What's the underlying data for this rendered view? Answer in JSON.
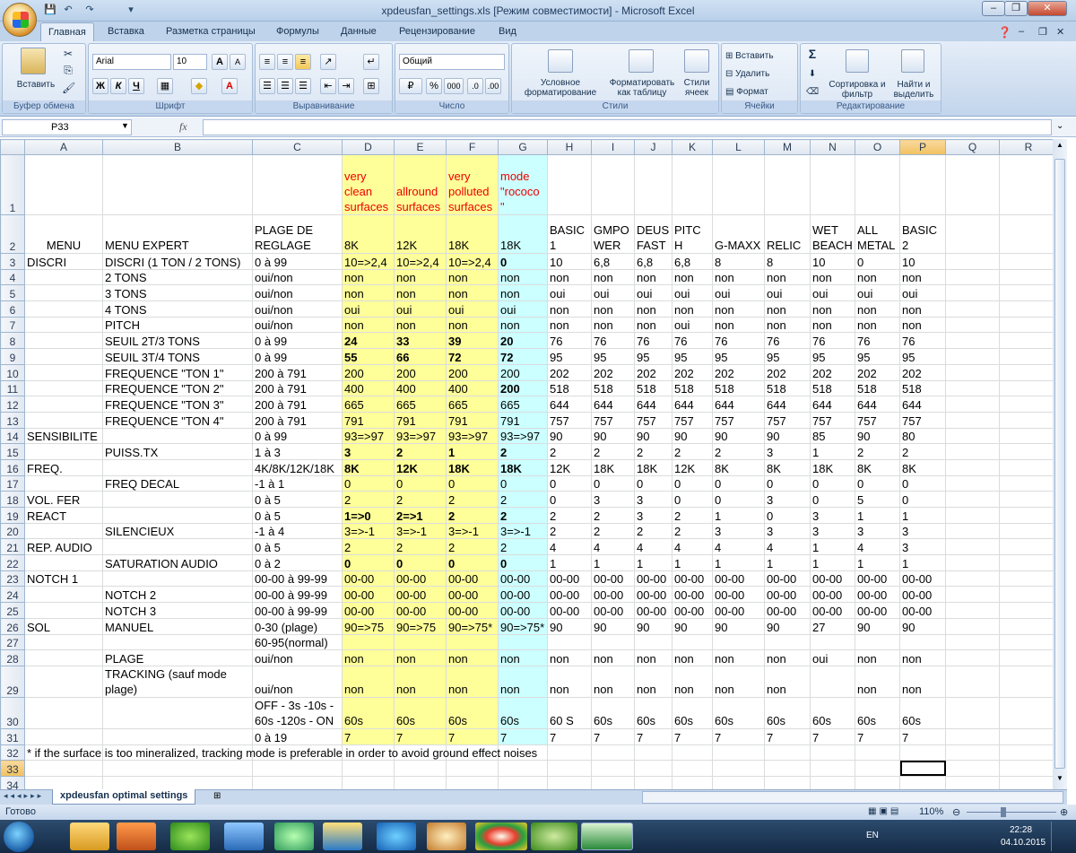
{
  "window": {
    "title": "xpdeusfan_settings.xls  [Режим совместимости] - Microsoft Excel",
    "min": "–",
    "max": "❐",
    "close": "✕"
  },
  "ribbon_tabs": [
    "Главная",
    "Вставка",
    "Разметка страницы",
    "Формулы",
    "Данные",
    "Рецензирование",
    "Вид"
  ],
  "ribbon": {
    "clipboard": {
      "group": "Буфер обмена",
      "paste": "Вставить"
    },
    "font": {
      "group": "Шрифт",
      "name": "Arial",
      "size": "10",
      "bold": "Ж",
      "italic": "К",
      "underline": "Ч",
      "grow": "A",
      "shrink": "A"
    },
    "alignment": {
      "group": "Выравнивание"
    },
    "number": {
      "group": "Число",
      "format": "Общий",
      "percent": "%",
      "thousands": "000"
    },
    "styles": {
      "group": "Стили",
      "conditional": "Условное форматирование",
      "table": "Форматировать как таблицу",
      "cell": "Стили ячеек"
    },
    "cells": {
      "group": "Ячейки",
      "insert": "Вставить",
      "delete": "Удалить",
      "format": "Формат"
    },
    "editing": {
      "group": "Редактирование",
      "sum": "Σ",
      "sort": "Сортировка и фильтр",
      "find": "Найти и выделить"
    }
  },
  "formula_bar": {
    "name_box": "P33",
    "fx": "fx",
    "content": ""
  },
  "columns": [
    "A",
    "B",
    "C",
    "D",
    "E",
    "F",
    "G",
    "H",
    "I",
    "J",
    "K",
    "L",
    "M",
    "N",
    "O",
    "P",
    "Q",
    "R"
  ],
  "rows": [
    {
      "n": "1",
      "c": [
        "",
        "",
        "",
        "very clean surfaces",
        "allround surfaces",
        "very polluted surfaces",
        "mode \"rococo \"",
        "",
        "",
        "",
        "",
        "",
        "",
        "",
        "",
        "",
        "",
        ""
      ]
    },
    {
      "n": "2",
      "c": [
        "MENU",
        "MENU EXPERT",
        "PLAGE DE REGLAGE",
        "8K",
        "12K",
        "18K",
        "18K",
        "BASIC 1",
        "GMPO WER",
        "DEUS FAST",
        "PITC H",
        "G-MAXX",
        "RELIC",
        "WET BEACH",
        "ALL METAL",
        "BASIC 2",
        "",
        ""
      ]
    },
    {
      "n": "3",
      "c": [
        "DISCRI",
        "DISCRI (1 TON / 2 TONS)",
        "0 à 99",
        "10=>2,4",
        "10=>2,4",
        "10=>2,4",
        "0",
        "10",
        "6,8",
        "6,8",
        "6,8",
        "8",
        "8",
        "10",
        "0",
        "10",
        "",
        ""
      ]
    },
    {
      "n": "4",
      "c": [
        "",
        "2 TONS",
        "oui/non",
        "non",
        "non",
        "non",
        "non",
        "non",
        "non",
        "non",
        "non",
        "non",
        "non",
        "non",
        "non",
        "non",
        "",
        ""
      ]
    },
    {
      "n": "5",
      "c": [
        "",
        "3 TONS",
        "oui/non",
        "non",
        "non",
        "non",
        "non",
        "oui",
        "oui",
        "oui",
        "oui",
        "oui",
        "oui",
        "oui",
        "oui",
        "oui",
        "",
        ""
      ]
    },
    {
      "n": "6",
      "c": [
        "",
        "4 TONS",
        "oui/non",
        "oui",
        "oui",
        "oui",
        "oui",
        "non",
        "non",
        "non",
        "non",
        "non",
        "non",
        "non",
        "non",
        "non",
        "",
        ""
      ]
    },
    {
      "n": "7",
      "c": [
        "",
        "PITCH",
        "oui/non",
        "non",
        "non",
        "non",
        "non",
        "non",
        "non",
        "non",
        "oui",
        "non",
        "non",
        "non",
        "non",
        "non",
        "",
        ""
      ]
    },
    {
      "n": "8",
      "c": [
        "",
        "SEUIL 2T/3 TONS",
        "0 à 99",
        "24",
        "33",
        "39",
        "20",
        "76",
        "76",
        "76",
        "76",
        "76",
        "76",
        "76",
        "76",
        "76",
        "",
        ""
      ]
    },
    {
      "n": "9",
      "c": [
        "",
        "SEUIL 3T/4 TONS",
        "0 à 99",
        "55",
        "66",
        "72",
        "72",
        "95",
        "95",
        "95",
        "95",
        "95",
        "95",
        "95",
        "95",
        "95",
        "",
        ""
      ]
    },
    {
      "n": "10",
      "c": [
        "",
        "FREQUENCE \"TON 1\"",
        "200 à 791",
        "200",
        "200",
        "200",
        "200",
        "202",
        "202",
        "202",
        "202",
        "202",
        "202",
        "202",
        "202",
        "202",
        "",
        ""
      ]
    },
    {
      "n": "11",
      "c": [
        "",
        "FREQUENCE \"TON 2\"",
        "200 à 791",
        "400",
        "400",
        "400",
        "200",
        "518",
        "518",
        "518",
        "518",
        "518",
        "518",
        "518",
        "518",
        "518",
        "",
        ""
      ]
    },
    {
      "n": "12",
      "c": [
        "",
        "FREQUENCE \"TON 3\"",
        "200 à 791",
        "665",
        "665",
        "665",
        "665",
        "644",
        "644",
        "644",
        "644",
        "644",
        "644",
        "644",
        "644",
        "644",
        "",
        ""
      ]
    },
    {
      "n": "13",
      "c": [
        "",
        "FREQUENCE \"TON 4\"",
        "200 à 791",
        "791",
        "791",
        "791",
        "791",
        "757",
        "757",
        "757",
        "757",
        "757",
        "757",
        "757",
        "757",
        "757",
        "",
        ""
      ]
    },
    {
      "n": "14",
      "c": [
        "SENSIBILITE",
        "",
        "0 à 99",
        "93=>97",
        "93=>97",
        "93=>97",
        "93=>97",
        "90",
        "90",
        "90",
        "90",
        "90",
        "90",
        "85",
        "90",
        "80",
        "",
        ""
      ]
    },
    {
      "n": "15",
      "c": [
        "",
        "PUISS.TX",
        "1 à 3",
        "3",
        "2",
        "1",
        "2",
        "2",
        "2",
        "2",
        "2",
        "2",
        "3",
        "1",
        "2",
        "2",
        "",
        ""
      ]
    },
    {
      "n": "16",
      "c": [
        "FREQ.",
        "",
        "4K/8K/12K/18K",
        "8K",
        "12K",
        "18K",
        "18K",
        "12K",
        "18K",
        "18K",
        "12K",
        "8K",
        "8K",
        "18K",
        "8K",
        "8K",
        "",
        ""
      ]
    },
    {
      "n": "17",
      "c": [
        "",
        "FREQ DECAL",
        "-1 à 1",
        "0",
        "0",
        "0",
        "0",
        "0",
        "0",
        "0",
        "0",
        "0",
        "0",
        "0",
        "0",
        "0",
        "",
        ""
      ]
    },
    {
      "n": "18",
      "c": [
        "VOL. FER",
        "",
        "0 à 5",
        "2",
        "2",
        "2",
        "2",
        "0",
        "3",
        "3",
        "0",
        "0",
        "3",
        "0",
        "5",
        "0",
        "",
        ""
      ]
    },
    {
      "n": "19",
      "c": [
        "REACT",
        "",
        "0 à 5",
        "1=>0",
        "2=>1",
        "2",
        "2",
        "2",
        "2",
        "3",
        "2",
        "1",
        "0",
        "3",
        "1",
        "1",
        "",
        ""
      ]
    },
    {
      "n": "20",
      "c": [
        "",
        "SILENCIEUX",
        "-1 à 4",
        "3=>-1",
        "3=>-1",
        "3=>-1",
        "3=>-1",
        "2",
        "2",
        "2",
        "2",
        "3",
        "3",
        "3",
        "3",
        "3",
        "",
        ""
      ]
    },
    {
      "n": "21",
      "c": [
        "REP. AUDIO",
        "",
        "0 à 5",
        "2",
        "2",
        "2",
        "2",
        "4",
        "4",
        "4",
        "4",
        "4",
        "4",
        "1",
        "4",
        "3",
        "",
        ""
      ]
    },
    {
      "n": "22",
      "c": [
        "",
        "SATURATION AUDIO",
        "0 à 2",
        "0",
        "0",
        "0",
        "0",
        "1",
        "1",
        "1",
        "1",
        "1",
        "1",
        "1",
        "1",
        "1",
        "",
        ""
      ]
    },
    {
      "n": "23",
      "c": [
        "NOTCH 1",
        "",
        "00-00 à 99-99",
        "00-00",
        "00-00",
        "00-00",
        "00-00",
        "00-00",
        "00-00",
        "00-00",
        "00-00",
        "00-00",
        "00-00",
        "00-00",
        "00-00",
        "00-00",
        "",
        ""
      ]
    },
    {
      "n": "24",
      "c": [
        "",
        "NOTCH 2",
        "00-00 à 99-99",
        "00-00",
        "00-00",
        "00-00",
        "00-00",
        "00-00",
        "00-00",
        "00-00",
        "00-00",
        "00-00",
        "00-00",
        "00-00",
        "00-00",
        "00-00",
        "",
        ""
      ]
    },
    {
      "n": "25",
      "c": [
        "",
        "NOTCH 3",
        "00-00 à 99-99",
        "00-00",
        "00-00",
        "00-00",
        "00-00",
        "00-00",
        "00-00",
        "00-00",
        "00-00",
        "00-00",
        "00-00",
        "00-00",
        "00-00",
        "00-00",
        "",
        ""
      ]
    },
    {
      "n": "26",
      "c": [
        "SOL",
        "MANUEL",
        "0-30 (plage)",
        "90=>75",
        "90=>75",
        "90=>75*",
        "90=>75*",
        "90",
        "90",
        "90",
        "90",
        "90",
        "90",
        "27",
        "90",
        "90",
        "",
        ""
      ]
    },
    {
      "n": "27",
      "c": [
        "",
        "",
        "60-95(normal)",
        "",
        "",
        "",
        "",
        "",
        "",
        "",
        "",
        "",
        "",
        "",
        "",
        "",
        "",
        ""
      ]
    },
    {
      "n": "28",
      "c": [
        "",
        "PLAGE",
        "oui/non",
        "non",
        "non",
        "non",
        "non",
        "non",
        "non",
        "non",
        "non",
        "non",
        "non",
        "oui",
        "non",
        "non",
        "",
        ""
      ]
    },
    {
      "n": "29",
      "c": [
        "",
        "TRACKING (sauf  mode plage)",
        "oui/non",
        "non",
        "non",
        "non",
        "non",
        "non",
        "non",
        "non",
        "non",
        "non",
        "non",
        "",
        "non",
        "non",
        "",
        ""
      ]
    },
    {
      "n": "30",
      "c": [
        "",
        "",
        "OFF - 3s -10s - 60s -120s - ON",
        "60s",
        "60s",
        "60s",
        "60s",
        "60 S",
        "60s",
        "60s",
        "60s",
        "60s",
        "60s",
        "60s",
        "60s",
        "60s",
        "",
        ""
      ]
    },
    {
      "n": "31",
      "c": [
        "",
        "",
        "0 à 19",
        "7",
        "7",
        "7",
        "7",
        "7",
        "7",
        "7",
        "7",
        "7",
        "7",
        "7",
        "7",
        "7",
        "",
        ""
      ]
    },
    {
      "n": "32",
      "c": [
        "* if the surface is too mineralized, tracking mode is preferable in order to avoid ground effect noises",
        "",
        "",
        "",
        "",
        "",
        "",
        "",
        "",
        "",
        "",
        "",
        "",
        "",
        "",
        "",
        "",
        ""
      ]
    },
    {
      "n": "33",
      "c": [
        "",
        "",
        "",
        "",
        "",
        "",
        "",
        "",
        "",
        "",
        "",
        "",
        "",
        "",
        "",
        "",
        "",
        ""
      ]
    },
    {
      "n": "34",
      "c": [
        "",
        "",
        "",
        "",
        "",
        "",
        "",
        "",
        "",
        "",
        "",
        "",
        "",
        "",
        "",
        "",
        "",
        ""
      ]
    }
  ],
  "sheet_tab": "xpdeusfan optimal settings",
  "status": {
    "ready": "Готово",
    "zoom": "110%"
  },
  "taskbar": {
    "lang": "EN",
    "time": "22:28",
    "date": "04.10.2015"
  },
  "colors": {
    "highlight_yellow": "#ffff99",
    "highlight_cyan": "#ccffff",
    "header_red": "#e00000"
  }
}
